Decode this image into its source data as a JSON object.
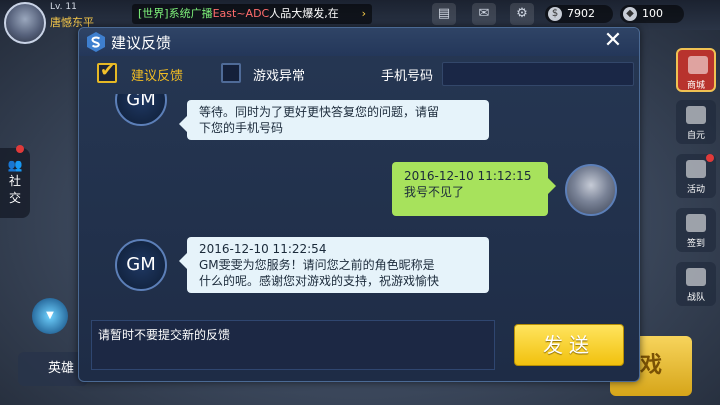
{
  "hud": {
    "level": "Lv. 11",
    "player_name": "唐憾东平",
    "broadcast": {
      "channel": "[世界]",
      "system": "系统广播",
      "name": "East~ADC",
      "text": "人品大爆发,在",
      "arrow": "›"
    },
    "coins": "7902",
    "diamonds": "100",
    "side_left_label_1": "社",
    "side_left_label_2": "交",
    "hero_label": "英雄",
    "big_button_text": "戏",
    "right_buttons": [
      "商城",
      "自元",
      "活动",
      "签到",
      "战队"
    ]
  },
  "dialog": {
    "title": "建议反馈",
    "close_icon": "close-icon",
    "tabs": [
      {
        "label": "建议反馈",
        "checked": true
      },
      {
        "label": "游戏异常",
        "checked": false
      }
    ],
    "phone_label": "手机号码",
    "phone_value": "",
    "messages": [
      {
        "sender": "GM",
        "text_line1": "等待。同时为了更好更快答复您的问题，请留",
        "text_line2": "下您的手机号码"
      },
      {
        "sender": "user",
        "time": "2016-12-10 11:12:15",
        "text": "我号不见了"
      },
      {
        "sender": "GM",
        "time": "2016-12-10 11:22:54",
        "text_line1": "GM雯雯为您服务！请问您之前的角色昵称是",
        "text_line2": "什么的呢。感谢您对游戏的支持，祝游戏愉快"
      }
    ],
    "gm_label": "GM",
    "input_placeholder": "请暂时不要提交新的反馈",
    "send_label": "发送"
  },
  "colors": {
    "accent_yellow": "#f2bd23",
    "gm_bubble": "#e6f3fa",
    "user_bubble": "#a7e25c",
    "dialog_bg": "#223250"
  }
}
